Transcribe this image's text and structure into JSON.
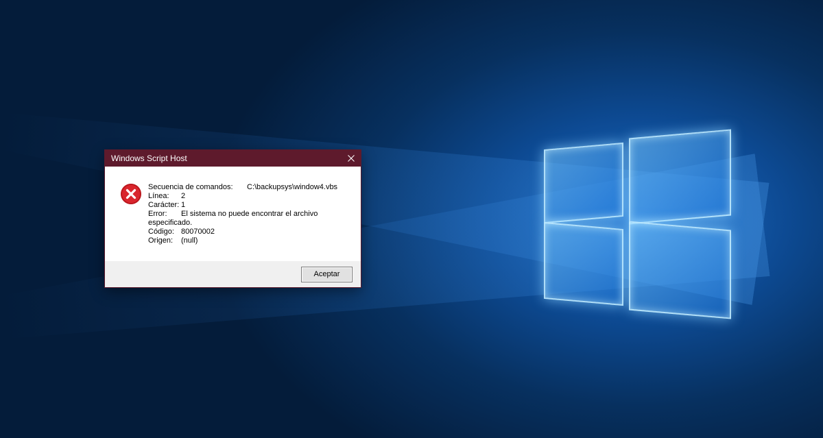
{
  "dialog": {
    "title": "Windows Script Host",
    "icon": "error-icon",
    "close_icon": "close-icon",
    "fields": {
      "script_label": "Secuencia de comandos:",
      "script_value": "C:\\backupsys\\window4.vbs",
      "line_label": "Línea:",
      "line_value": "2",
      "char_label": "Carácter:",
      "char_value": "1",
      "error_label": "Error:",
      "error_value_1": "El sistema no puede encontrar el archivo",
      "error_value_2": "especificado.",
      "code_label": "Código:",
      "code_value": "80070002",
      "origin_label": "Origen:",
      "origin_value": "(null)"
    },
    "ok_label": "Aceptar"
  },
  "colors": {
    "titlebar": "#5e1a2c",
    "error_red": "#c8161d",
    "desktop_blue": "#0d4a93"
  }
}
